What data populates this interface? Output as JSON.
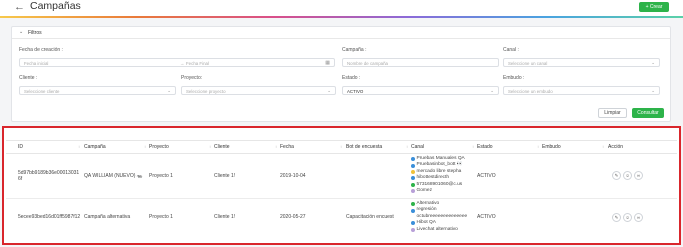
{
  "header": {
    "back_icon": "arrow-left-icon",
    "title": "Campañas",
    "create_label": "+ Crear",
    "accent": "#2db34a"
  },
  "filters": {
    "title": "Filtros",
    "fecha_label": "Fecha de creación :",
    "fecha_inicial_placeholder": "Fecha inicial",
    "fecha_final_placeholder": "Fecha Final",
    "campana_label": "Campaña :",
    "campana_placeholder": "Nombre de campaña",
    "canal_label": "Canal :",
    "canal_placeholder": "Seleccione un canal",
    "cliente_label": "Cliente :",
    "cliente_placeholder": "Seleccione cliente",
    "proyecto_label": "Proyecto:",
    "proyecto_placeholder": "Seleccione proyecto",
    "estado_label": "Estado :",
    "estado_value": "ACTIVO",
    "embudo_label": "Embudo :",
    "embudo_placeholder": "Seleccione un embudo",
    "limpiar_label": "Limpiar",
    "consultar_label": "Consultar"
  },
  "table": {
    "columns": [
      "ID",
      "Campaña",
      "Proyecto",
      "Cliente",
      "Fecha",
      "Bot de encuesta",
      "Canal",
      "Estado",
      "Embudo",
      "Acción"
    ],
    "rows": [
      {
        "id_line1": "5d97bb9189b36e00013031",
        "id_line2": "6f",
        "campana": "QA WILLIAM (NUEVO) 🦡",
        "proyecto": "Proyecto 1",
        "cliente": "Cliente 1!",
        "fecha": "2019-10-04",
        "bot": "",
        "canales": [
          {
            "text": "Pruebas Manuales QA",
            "color": "#3b8fd9"
          },
          {
            "text": "Pruebasinbot_bott 👀",
            "color": "#3b8fd9"
          },
          {
            "text": "mercado libre stepha",
            "color": "#f0c23a"
          },
          {
            "text": "hibottestdirecth",
            "color": "#3b8fd9"
          },
          {
            "text": "573168901060@c.us",
            "color": "#2db34a"
          },
          {
            "text": "Gomez",
            "color": "#b8a0d8"
          }
        ],
        "estado": "ACTIVO"
      },
      {
        "id_line1": "5ecee93bed16d01ff5987f12",
        "id_line2": "",
        "campana": "Campaña alternativa",
        "proyecto": "Proyecto 1",
        "cliente": "Cliente 1!",
        "fecha": "2020-05-27",
        "bot": "Capacitación encuest",
        "canales": [
          {
            "text": "Alternativo",
            "color": "#2db34a"
          },
          {
            "text": "regresión",
            "color": "#3b8fd9"
          },
          {
            "text": "octubreeeeeeeeeeeeee",
            "color": "#ffffff"
          },
          {
            "text": "Hibot QA",
            "color": "#3b8fd9"
          },
          {
            "text": "Livechat alternativo",
            "color": "#b8a0d8"
          }
        ],
        "estado": "ACTIVO"
      }
    ],
    "action_icons": [
      "edit-icon",
      "user-icon",
      "attach-icon"
    ]
  },
  "highlight_color": "#d9262c"
}
